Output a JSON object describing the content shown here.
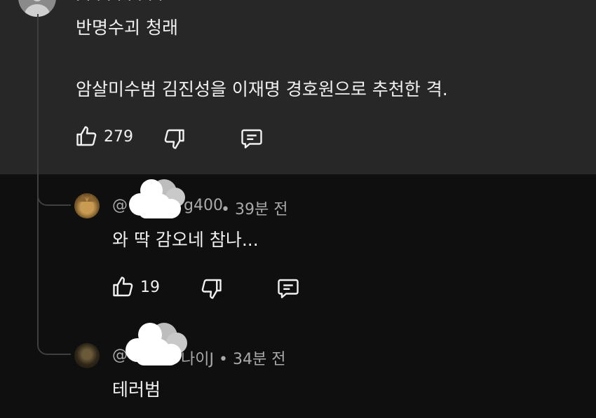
{
  "comment": {
    "line1": "반명수괴 청래",
    "line2": "암살미수범 김진성을 이재명 경호원으로 추천한 격.",
    "likes": "279"
  },
  "replies": [
    {
      "username_visible": "@",
      "username_tail": "g400",
      "time": "• 39분 전",
      "text": "와 딱 감오네 참나...",
      "likes": "19"
    },
    {
      "username_visible": "@",
      "username_tail": "나이J",
      "time": "• 34분 전",
      "text": "테러범"
    }
  ],
  "icons": [
    "thumbs-up-icon",
    "thumbs-down-icon",
    "reply-icon"
  ],
  "colors": {
    "top_bg": "#272727",
    "bottom_bg": "#0f0f0f",
    "text": "#f1f1f1",
    "meta": "#aaaaaa"
  }
}
